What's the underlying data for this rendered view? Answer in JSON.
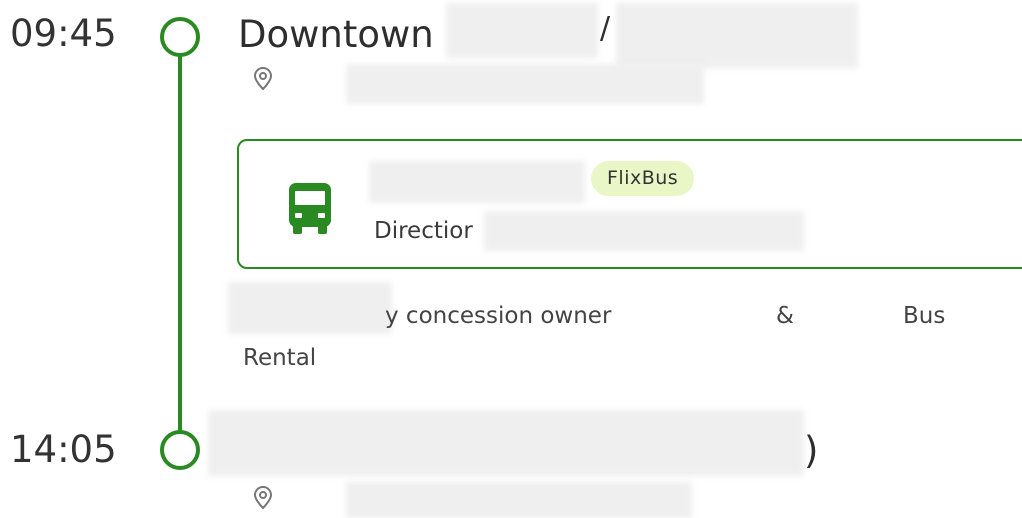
{
  "departure": {
    "time": "09:45",
    "stop_name": "Downtown",
    "stop_separator": "/"
  },
  "ride": {
    "operator": "FlixBus",
    "direction": "Directior"
  },
  "operated_by": {
    "part1": "y concession owner",
    "part2": "&",
    "part3": "Bus",
    "part4": "Rental"
  },
  "arrival": {
    "time": "14:05",
    "stop_name_suffix": ")"
  },
  "colors": {
    "accent": "#2a8a22",
    "badge_bg": "#e9f7c6"
  },
  "icons": {
    "stop": "circle-stop-icon",
    "location": "location-pin-icon",
    "vehicle": "bus-icon"
  }
}
